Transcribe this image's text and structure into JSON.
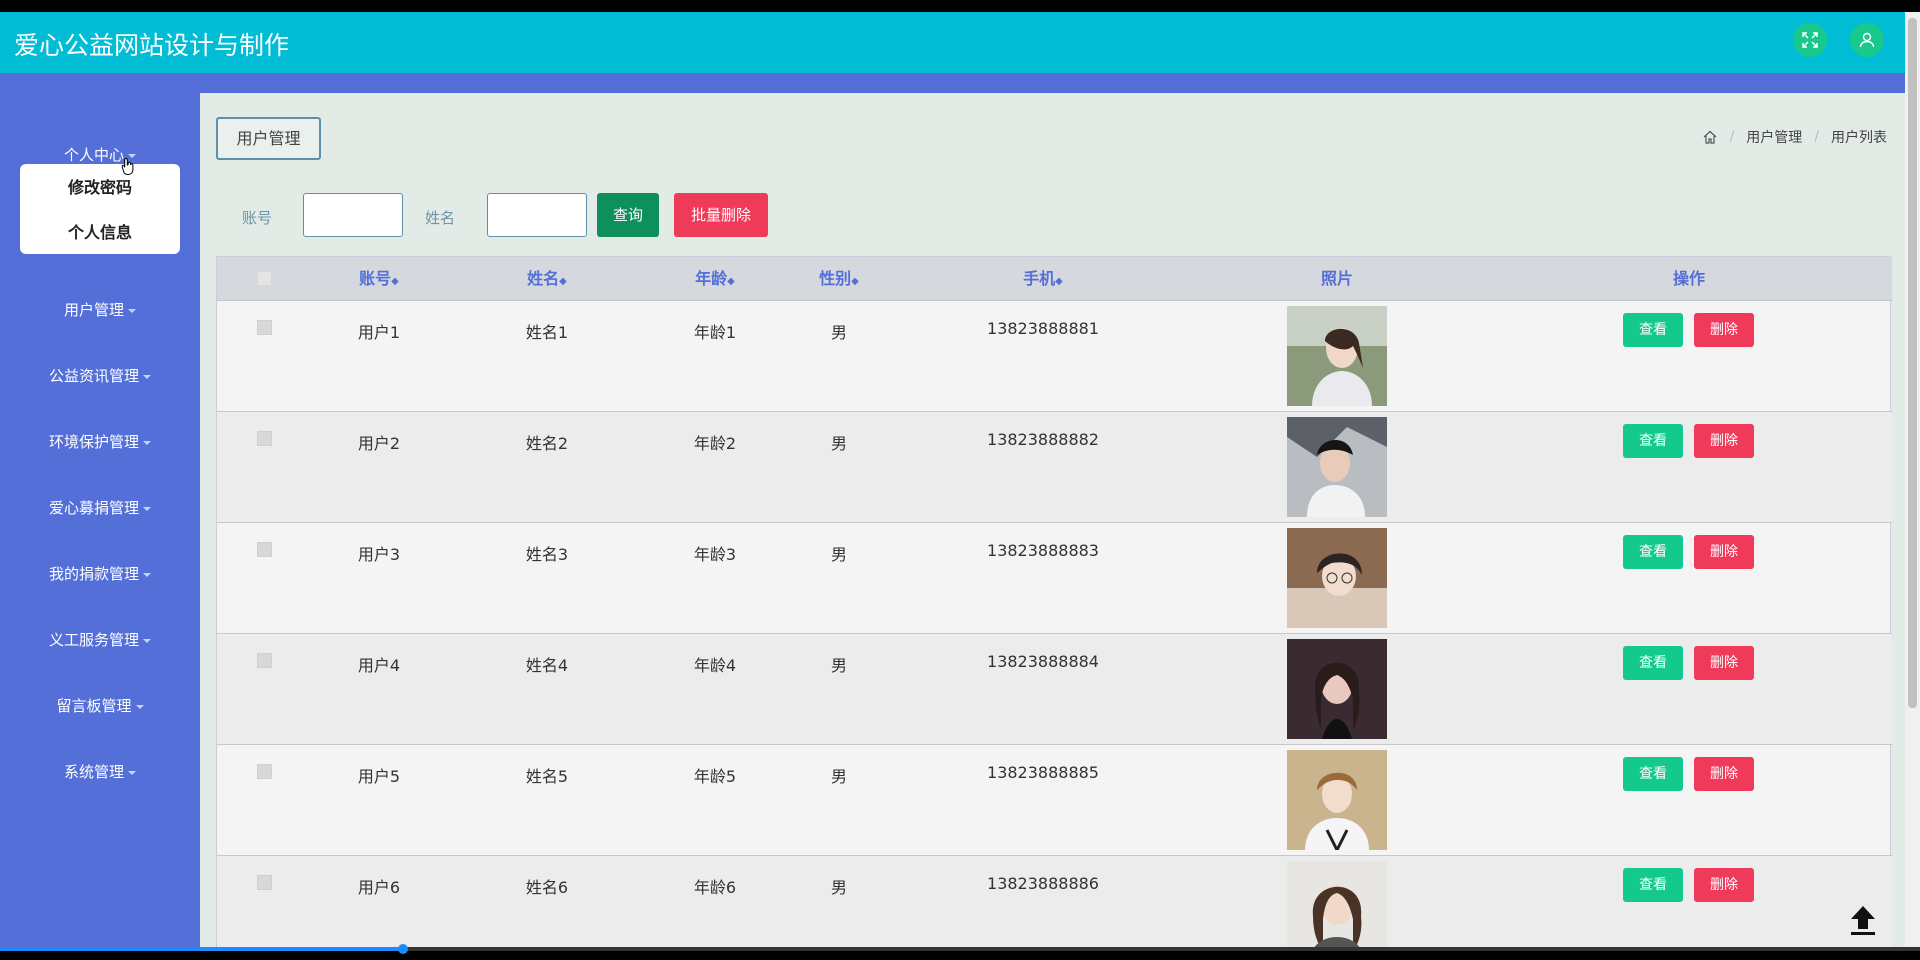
{
  "app": {
    "title": "爱心公益网站设计与制作"
  },
  "header_buttons": [
    {
      "icon": "fullscreen-icon"
    },
    {
      "icon": "user-icon"
    }
  ],
  "sidebar": {
    "items": [
      {
        "label": "个人中心"
      },
      {
        "label": "用户管理"
      },
      {
        "label": "公益资讯管理"
      },
      {
        "label": "环境保护管理"
      },
      {
        "label": "爱心募捐管理"
      },
      {
        "label": "我的捐款管理"
      },
      {
        "label": "义工服务管理"
      },
      {
        "label": "留言板管理"
      },
      {
        "label": "系统管理"
      }
    ],
    "dropdown": [
      {
        "label": "修改密码"
      },
      {
        "label": "个人信息"
      }
    ]
  },
  "page": {
    "tab": "用户管理",
    "breadcrumb": [
      "用户管理",
      "用户列表"
    ]
  },
  "search": {
    "account_label": "账号",
    "name_label": "姓名",
    "account_value": "",
    "name_value": "",
    "query_label": "查询",
    "bulk_delete_label": "批量删除"
  },
  "table": {
    "columns": [
      "账号",
      "姓名",
      "年龄",
      "性别",
      "手机",
      "照片",
      "操作"
    ],
    "sortable": [
      "账号",
      "姓名",
      "年龄",
      "性别",
      "手机"
    ],
    "view_label": "查看",
    "delete_label": "删除",
    "rows": [
      {
        "account": "用户1",
        "name": "姓名1",
        "age": "年龄1",
        "gender": "男",
        "phone": "13823888881"
      },
      {
        "account": "用户2",
        "name": "姓名2",
        "age": "年龄2",
        "gender": "男",
        "phone": "13823888882"
      },
      {
        "account": "用户3",
        "name": "姓名3",
        "age": "年龄3",
        "gender": "男",
        "phone": "13823888883"
      },
      {
        "account": "用户4",
        "name": "姓名4",
        "age": "年龄4",
        "gender": "男",
        "phone": "13823888884"
      },
      {
        "account": "用户5",
        "name": "姓名5",
        "age": "年龄5",
        "gender": "男",
        "phone": "13823888885"
      },
      {
        "account": "用户6",
        "name": "姓名6",
        "age": "年龄6",
        "gender": "男",
        "phone": "13823888886"
      }
    ]
  },
  "colors": {
    "header": "#00bcd4",
    "sidebar": "#5470d8",
    "query_button": "#0f8f5c",
    "danger": "#ef3a5a",
    "view_button": "#13c98d"
  }
}
